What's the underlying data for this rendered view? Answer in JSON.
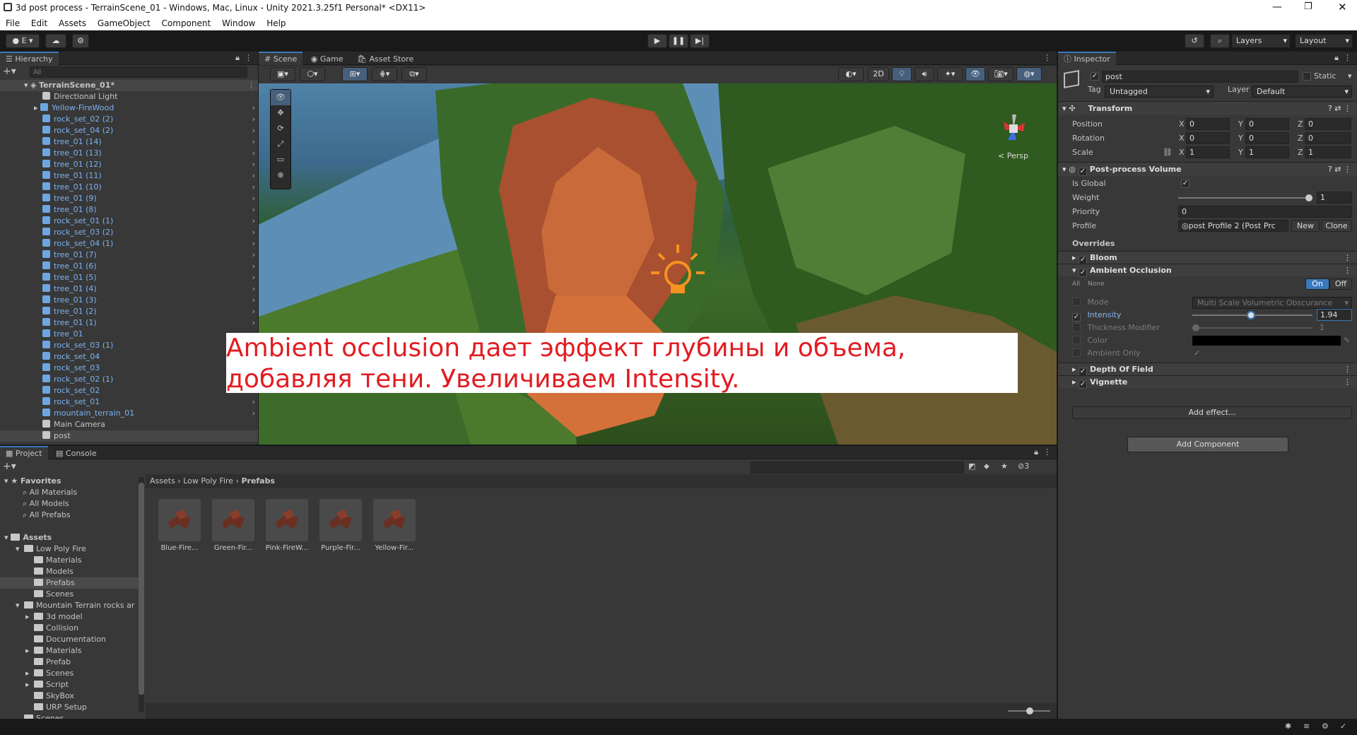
{
  "window": {
    "title": "3d post process - TerrainScene_01 - Windows, Mac, Linux - Unity 2021.3.25f1 Personal* <DX11>"
  },
  "menu": [
    "File",
    "Edit",
    "Assets",
    "GameObject",
    "Component",
    "Window",
    "Help"
  ],
  "toolbar": {
    "account": "E",
    "layers": "Layers",
    "layout": "Layout"
  },
  "hierarchy": {
    "tab": "Hierarchy",
    "search_placeholder": "All",
    "scene": "TerrainScene_01*",
    "items": [
      "Directional Light",
      "Yellow-FireWood",
      "rock_set_02 (2)",
      "rock_set_04 (2)",
      "tree_01 (14)",
      "tree_01 (13)",
      "tree_01 (12)",
      "tree_01 (11)",
      "tree_01 (10)",
      "tree_01 (9)",
      "tree_01 (8)",
      "rock_set_01 (1)",
      "rock_set_03 (2)",
      "rock_set_04 (1)",
      "tree_01 (7)",
      "tree_01 (6)",
      "tree_01 (5)",
      "tree_01 (4)",
      "tree_01 (3)",
      "tree_01 (2)",
      "tree_01 (1)",
      "tree_01",
      "rock_set_03 (1)",
      "rock_set_04",
      "rock_set_03",
      "rock_set_02 (1)",
      "rock_set_02",
      "rock_set_01",
      "mountain_terrain_01",
      "Main Camera",
      "post"
    ]
  },
  "scene_tabs": [
    "Scene",
    "Game",
    "Asset Store"
  ],
  "scene_toolbar": {
    "mode_2d": "2D",
    "persp": "< Persp"
  },
  "overlay_text": "Ambient occlusion дает эффект глубины и объема, добавляя тени. Увеличиваем Intensity.",
  "inspector": {
    "tab": "Inspector",
    "object_name": "post",
    "static_label": "Static",
    "tag_label": "Tag",
    "tag_value": "Untagged",
    "layer_label": "Layer",
    "layer_value": "Default",
    "transform": {
      "title": "Transform",
      "position": {
        "label": "Position",
        "x": "0",
        "y": "0",
        "z": "0"
      },
      "rotation": {
        "label": "Rotation",
        "x": "0",
        "y": "0",
        "z": "0"
      },
      "scale": {
        "label": "Scale",
        "x": "1",
        "y": "1",
        "z": "1"
      }
    },
    "ppv": {
      "title": "Post-process Volume",
      "is_global": "Is Global",
      "weight_label": "Weight",
      "weight_value": "1",
      "priority_label": "Priority",
      "priority_value": "0",
      "profile_label": "Profile",
      "profile_value": "post Profile 2 (Post Prc",
      "new": "New",
      "clone": "Clone",
      "overrides": "Overrides",
      "bloom": "Bloom",
      "ao": "Ambient Occlusion",
      "all": "All",
      "none": "None",
      "on": "On",
      "off": "Off",
      "mode_label": "Mode",
      "mode_value": "Multi Scale Volumetric Obscurance",
      "intensity_label": "Intensity",
      "intensity_value": "1.94",
      "thickness_label": "Thickness Modifier",
      "thickness_value": "1",
      "color_label": "Color",
      "ambient_only_label": "Ambient Only",
      "dof": "Depth Of Field",
      "vignette": "Vignette",
      "add_effect": "Add effect...",
      "intensity_fraction": 0.49,
      "weight_fraction": 1.0
    },
    "add_component": "Add Component"
  },
  "project": {
    "tabs": [
      "Project",
      "Console"
    ],
    "breadcrumb": [
      "Assets",
      "Low Poly Fire",
      "Prefabs"
    ],
    "hidden_count": "3",
    "favorites": {
      "title": "Favorites",
      "items": [
        "All Materials",
        "All Models",
        "All Prefabs"
      ]
    },
    "assets": {
      "title": "Assets",
      "items": [
        "Low Poly Fire",
        "Materials",
        "Models",
        "Prefabs",
        "Scenes",
        "Mountain Terrain rocks ar",
        "3d model",
        "Collision",
        "Documentation",
        "Materials",
        "Prefab",
        "Scenes",
        "Script",
        "SkyBox",
        "URP Setup",
        "Scenes"
      ]
    },
    "tiles": [
      "Blue-Fire...",
      "Green-Fir...",
      "Pink-FireW...",
      "Purple-Fir...",
      "Yellow-Fir..."
    ]
  },
  "colors": {
    "accent": "#3a79bb",
    "overlay_text": "#e21c22",
    "prefab_blue": "#7cb2f0",
    "sun": "#f7931e"
  }
}
